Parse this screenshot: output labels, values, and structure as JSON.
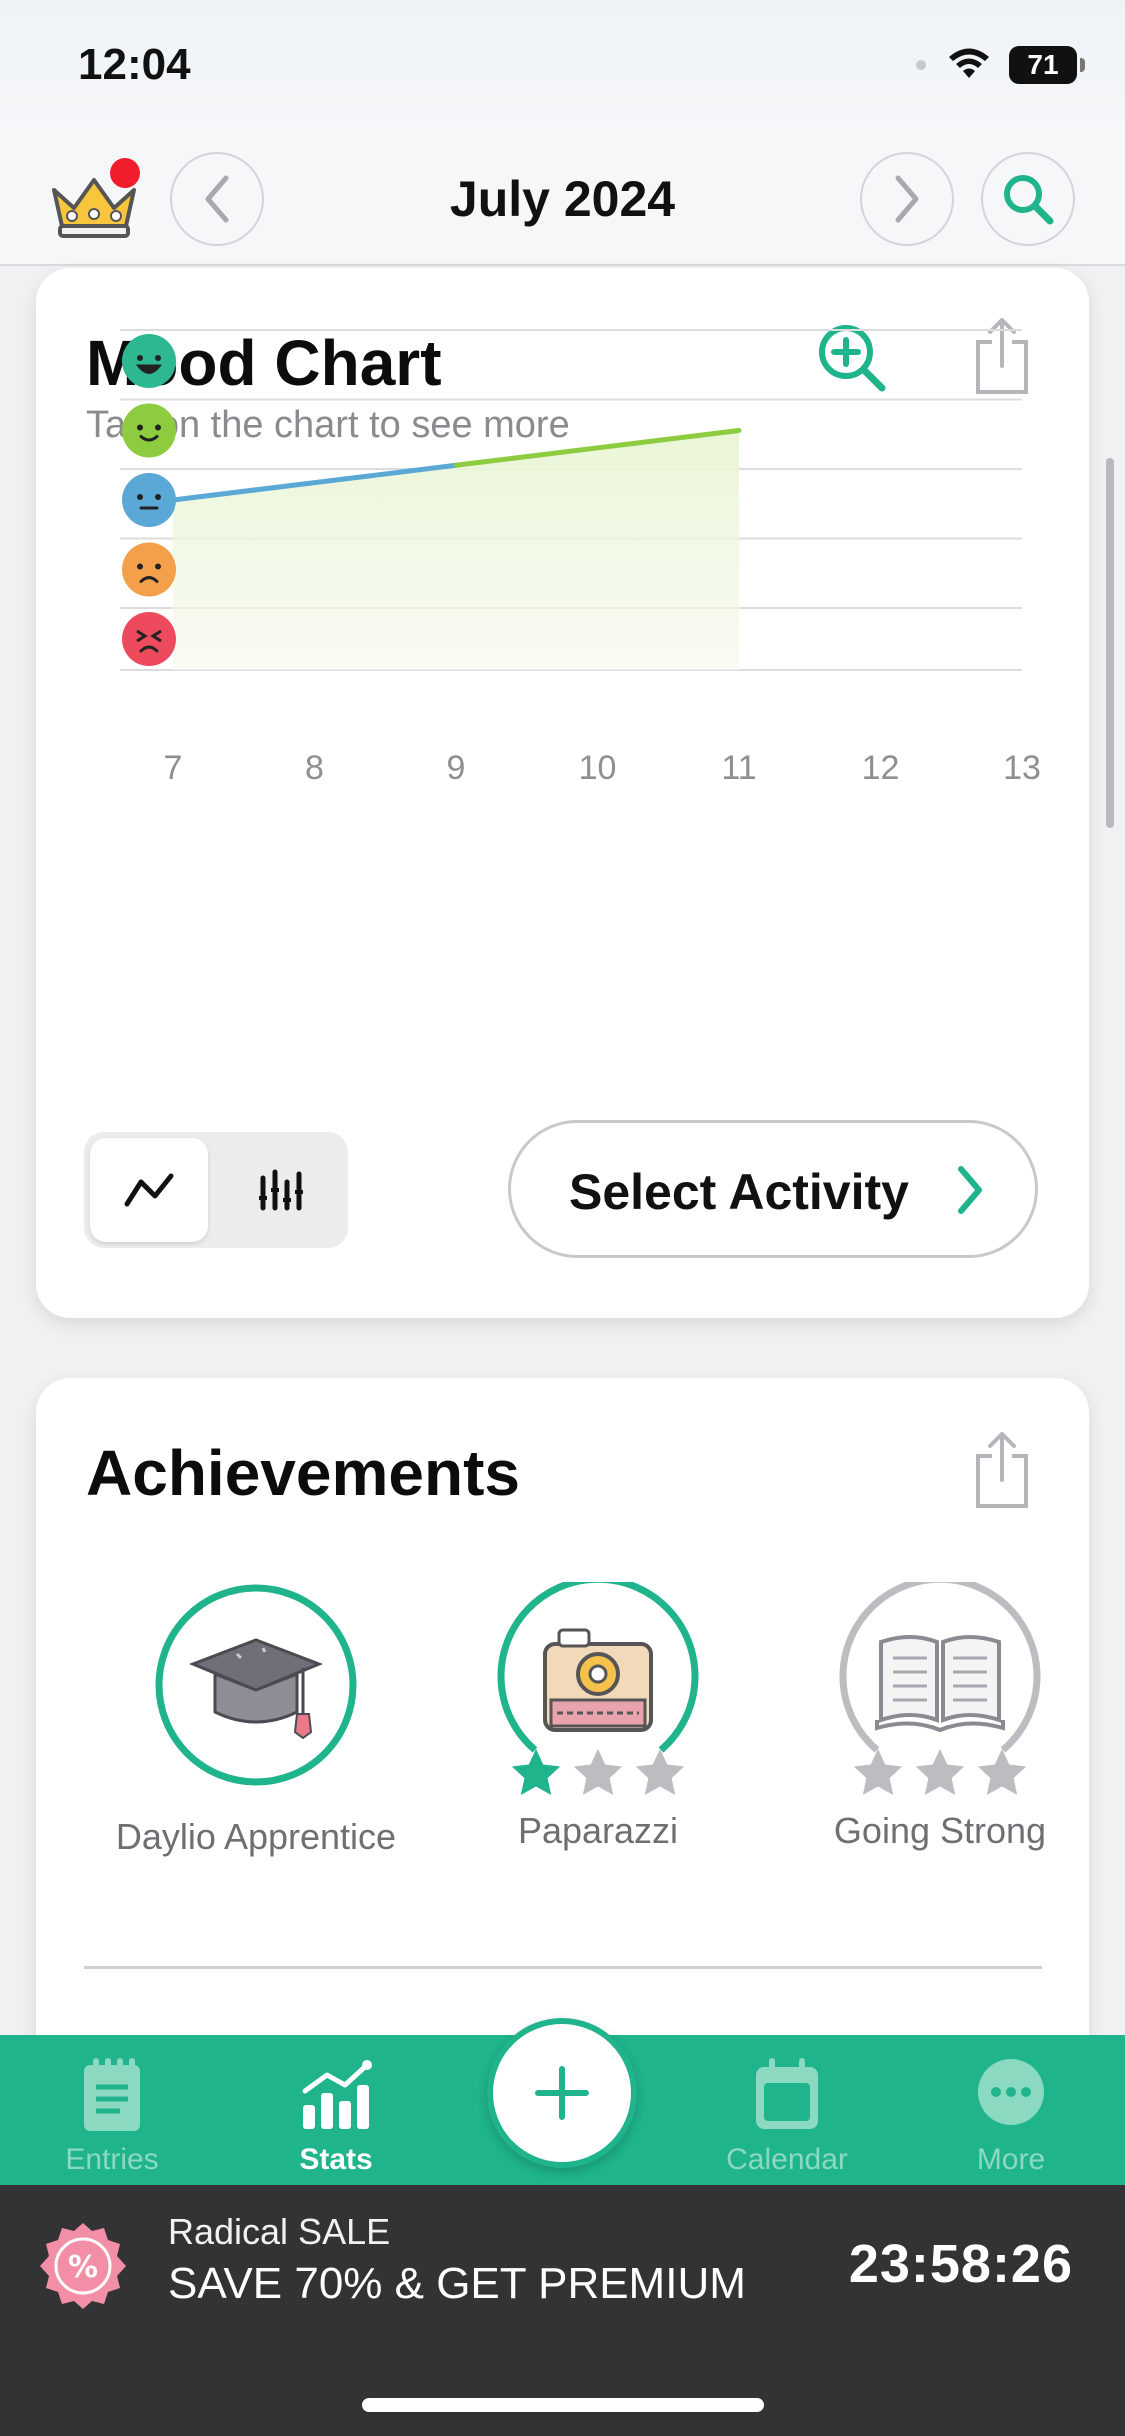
{
  "status_bar": {
    "time": "12:04",
    "battery": "71"
  },
  "header": {
    "month": "July 2024"
  },
  "mood_chart": {
    "title": "Mood Chart",
    "subtitle": "Tap on the chart to see more",
    "select_activity_label": "Select Activity"
  },
  "chart_data": {
    "type": "line",
    "x": [
      7,
      9,
      11
    ],
    "y": [
      3,
      3.5,
      4
    ],
    "x_ticks": [
      "7",
      "8",
      "9",
      "10",
      "11",
      "12",
      "13"
    ],
    "y_levels": [
      "awful",
      "bad",
      "meh",
      "good",
      "rad"
    ],
    "xlim": [
      7,
      13
    ],
    "ylim": [
      1,
      5
    ],
    "grid": true,
    "colors": {
      "meh": "#5aa8d6",
      "good": "#8dcc3f",
      "rad": "#2db891",
      "bad": "#f4a04a",
      "awful": "#ee4a5e"
    }
  },
  "achievements": {
    "title": "Achievements",
    "items": [
      {
        "label": "Daylio Apprentice",
        "stars": null
      },
      {
        "label": "Paparazzi",
        "stars": 1,
        "max_stars": 3
      },
      {
        "label": "Going Strong",
        "stars": 0,
        "max_stars": 3
      }
    ]
  },
  "tabs": [
    {
      "label": "Entries",
      "active": false
    },
    {
      "label": "Stats",
      "active": true
    },
    {
      "label": "Calendar",
      "active": false
    },
    {
      "label": "More",
      "active": false
    }
  ],
  "promo": {
    "subtitle": "Radical SALE",
    "headline": "SAVE 70% & GET PREMIUM",
    "timer": "23:58:26"
  },
  "theme": {
    "accent": "#1fb48b"
  }
}
